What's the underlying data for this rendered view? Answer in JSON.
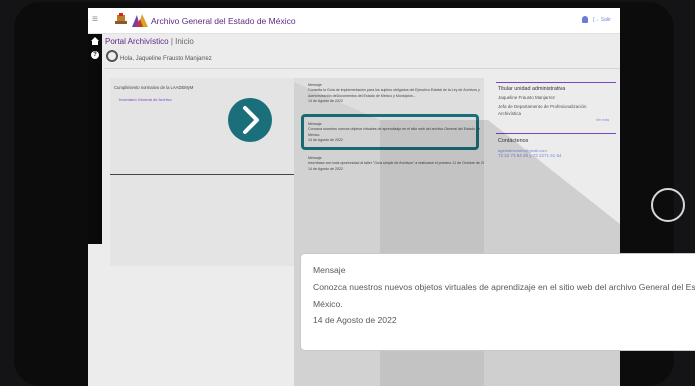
{
  "app": {
    "title": "Archivo General del Estado de México",
    "exit_label": "[→ Salir"
  },
  "breadcrumb": {
    "portal": "Portal Archivístico",
    "separator": "|",
    "current": "Inicio"
  },
  "user": {
    "greeting": "Hola, Jaqueline Frausto Manjarrez"
  },
  "left_panel": {
    "title": "Cumplimiento normativo de la LAADEMyM",
    "link": "Inventario General de Archivo"
  },
  "messages": [
    {
      "label": "Mensaje",
      "lines": [
        "Consulta la Guía de implementación para los sujetos obligados del Ejecutivo Estatal de la Ley de Archivos y",
        "Administración deDocumentos del Estado de México y Municipios..."
      ],
      "date": "14 de Agosto de 2022"
    },
    {
      "label": "Mensaje",
      "lines": [
        "Conozca nuestros nuevos objetos virtuales de aprendizaje en el sitio web del archivo General del Estado de",
        "México."
      ],
      "date": "14 de Agosto de 2022"
    },
    {
      "label": "Mensaje",
      "lines": [
        "Inscríbase con toda oportunidad al taller \"Guía simple de Archivos\" a realizarse el próximo 11 de Octubre de 2022."
      ],
      "date": "14 de Agosto de 2022"
    }
  ],
  "titular": {
    "heading": "Titular unidad administrativa",
    "name": "Jaqueline Frausto Manjarrez",
    "role_lines": [
      "Jefa de Departamento de Profesionalización",
      "Archivística"
    ],
    "ver_mas": "Ver más"
  },
  "contacto": {
    "heading": "Contáctenos",
    "email": "agemdirectorio@gmail.com",
    "phones": "72 22 73 94 28 y 72 2271 61 64"
  },
  "popup": {
    "label": "Mensaje",
    "line1": "Conozca nuestros nuevos objetos virtuales de aprendizaje en el sitio web del archivo General del Es",
    "line2": "México.",
    "date": "14 de Agosto de 2022"
  },
  "colors": {
    "accent_purple": "#5b2a86",
    "highlight_teal": "#1b6f7a",
    "link_blue": "#7a88d8"
  }
}
